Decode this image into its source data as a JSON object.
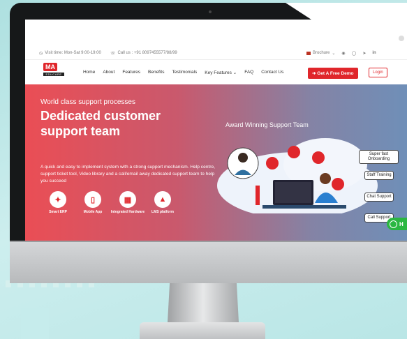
{
  "topbar": {
    "visit": "Visit time: Mon-Sat 9:00-19:00",
    "call": "Call us : +91 8097455577/88/99",
    "brochure": "Brochure"
  },
  "logo": {
    "mark": "MA",
    "sub": "EDUCARE"
  },
  "nav": {
    "links": [
      "Home",
      "About",
      "Features",
      "Benefits",
      "Testimonials",
      "Key Features",
      "FAQ",
      "Contact Us"
    ],
    "demo": "Get A Free Demo",
    "login": "Login"
  },
  "hero": {
    "kicker": "World class support processes",
    "title": "Dedicated customer support team",
    "description": "A quick and easy to implement system with a strong support mechanism. Help centre, support ticket tool, Video library and a call/email away dedicated support team to help you succeed",
    "features": [
      {
        "label": "Smart ERP",
        "icon": "magic-wand-icon"
      },
      {
        "label": "Mobile App",
        "icon": "mobile-icon"
      },
      {
        "label": "Integrated Hardware",
        "icon": "chip-icon"
      },
      {
        "label": "LMS platform",
        "icon": "graduation-cap-icon"
      }
    ]
  },
  "illustration": {
    "heading": "Award Winning Support Team",
    "pills": [
      "Super fast Onboarding",
      "Staff Training",
      "Chat Support",
      "Call Support"
    ]
  },
  "colors": {
    "brand": "#e0262b",
    "whatsapp": "#2bb741"
  }
}
